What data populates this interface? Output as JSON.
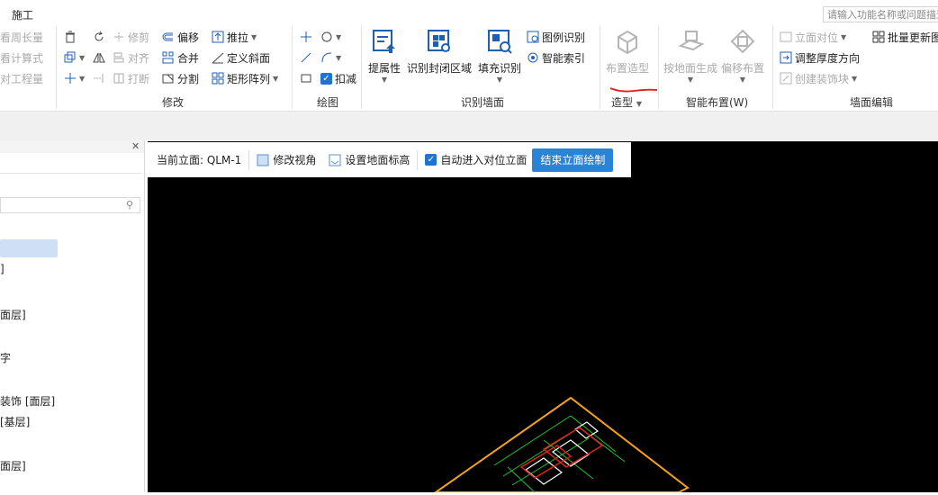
{
  "menu": {
    "tab_label": "施工"
  },
  "search": {
    "placeholder": "请输入功能名称或问题描述"
  },
  "ribbon": {
    "left_partial": {
      "items": [
        "看周长量",
        "看计算式",
        "对工程量"
      ]
    },
    "modify": {
      "label": "修改",
      "items": {
        "trim": "修剪",
        "offset": "偏移",
        "push_pull": "推拉",
        "align": "对齐",
        "merge": "合并",
        "define_slope": "定义斜面",
        "break": "打断",
        "split": "分割",
        "rect_array": "矩形阵列"
      }
    },
    "draw": {
      "label": "绘图",
      "deduct": "扣减"
    },
    "identify_wall": {
      "label": "识别墙面",
      "extract_props": "提属性",
      "identify_closed": "识别封闭区域",
      "fill_identify": "填充识别",
      "legend_identify": "图例识别",
      "smart_index": "智能索引"
    },
    "modeling": {
      "label": "造型",
      "place_shape": "布置造型"
    },
    "smart_place": {
      "label": "智能布置(W)",
      "by_floor": "按地面生成",
      "offset_place": "偏移布置"
    },
    "wall_edit": {
      "label": "墙面编辑",
      "elevation_align": "立面对位",
      "batch_update": "批量更新图",
      "adjust_thickness": "调整厚度方向",
      "create_deco": "创建装饰块"
    }
  },
  "left_panel": {
    "tree_items": [
      "]",
      "面层]",
      "字",
      "装饰 [面层]",
      "[基层]",
      "面层]"
    ]
  },
  "viewport_toolbar": {
    "current_elevation_label": "当前立面: QLM-1",
    "modify_view": "修改视角",
    "set_floor_elev": "设置地面标高",
    "auto_enter": "自动进入对位立面",
    "end_draw": "结束立面绘制"
  },
  "colors": {
    "accent": "#2b83d6",
    "viewport_bg": "#000000",
    "drawing_outline": "#f5a21a",
    "drawing_lines": "#1fbf2a",
    "annotation_red": "#e0201b"
  }
}
